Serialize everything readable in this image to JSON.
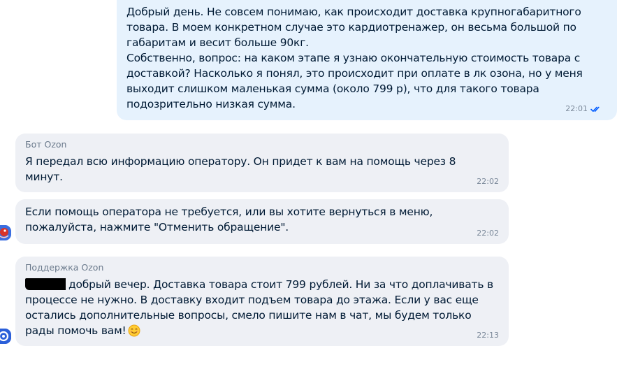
{
  "messages": [
    {
      "direction": "outgoing",
      "lines": [
        "Добрый день. Не совсем понимаю, как происходит доставка крупногабаритного",
        "товара. В моем конкретном случае это кардиотренажер, он весьма большой по",
        "габаритам и весит больше 90кг.",
        "Собственно, вопрос: на каком этапе я узнаю окончательную стоимость товара с",
        "доставкой? Насколько я понял, это происходит при оплате в лк озона, но у меня",
        "выходит слишком маленькая сумма (около 799 р), что для такого товара",
        "подозрительно низкая сумма."
      ],
      "time": "22:01",
      "status_icon": "double-check-icon"
    },
    {
      "direction": "incoming",
      "sender": "Бот Ozon",
      "lines": [
        "Я передал всю информацию оператору. Он придет к вам на помощь через 8",
        "минут."
      ],
      "time": "22:02"
    },
    {
      "direction": "incoming",
      "sender": "",
      "lines": [
        "Если помощь оператора не требуется, или вы хотите вернуться в меню,",
        "пожалуйста, нажмите \"Отменить обращение\"."
      ],
      "time": "22:02",
      "avatar": "bot-avatar-icon"
    },
    {
      "direction": "incoming",
      "sender": "Поддержка Ozon",
      "redacted_prefix": true,
      "first_line_rest": "добрый вечер. Доставка товара стоит 799 рублей. Ни за что доплачивать в",
      "lines": [
        "процессе не нужно. В доставку входит подъем товара до этажа. Если у вас еще",
        "остались дополнительные вопросы, смело пишите нам в чат, мы будем только",
        "рады помочь вам!"
      ],
      "emoji": "smiling-face-icon",
      "time": "22:13",
      "avatar": "support-avatar-icon"
    }
  ],
  "colors": {
    "outgoing_bubble": "#e6f2fd",
    "incoming_bubble": "#eef0f5",
    "read_ticks": "#005bff"
  }
}
